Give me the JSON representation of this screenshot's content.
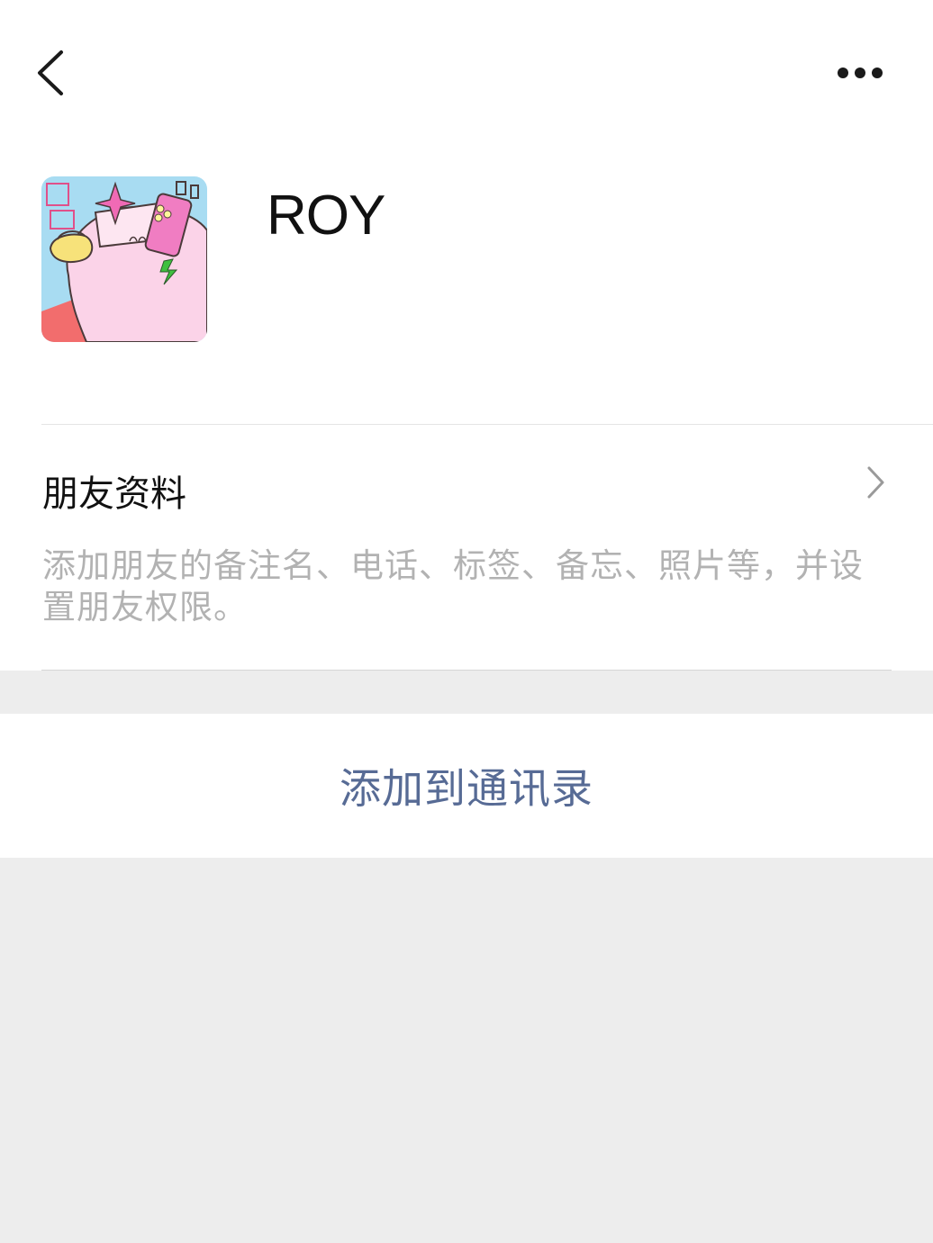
{
  "header": {
    "back_icon": "chevron-left-icon",
    "more_icon": "more-dots-icon"
  },
  "profile": {
    "name": "ROY",
    "avatar_icon": "cartoon-avatar"
  },
  "friend_info": {
    "title": "朋友资料",
    "description": "添加朋友的备注名、电话、标签、备忘、照片等，并设置朋友权限。",
    "chevron_icon": "chevron-right-icon"
  },
  "actions": {
    "add_to_contacts_label": "添加到通讯录"
  },
  "colors": {
    "page_background": "#ededed",
    "card_background": "#ffffff",
    "link_color": "#576b95",
    "secondary_text": "#b2b2b2"
  }
}
